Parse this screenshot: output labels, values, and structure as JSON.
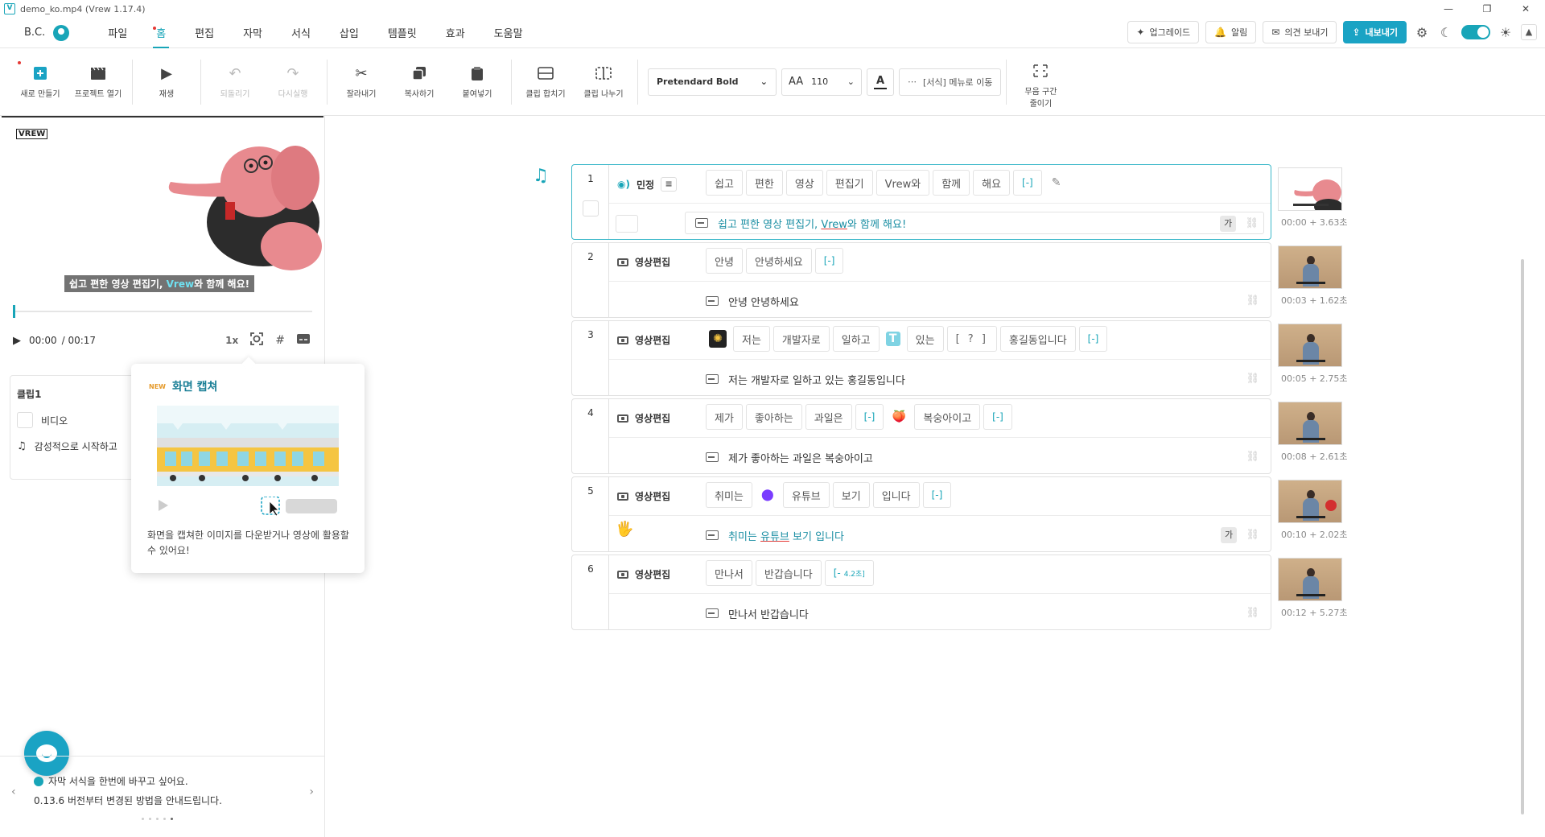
{
  "window": {
    "title": "demo_ko.mp4 (Vrew 1.17.4)",
    "controls": [
      "—",
      "❐",
      "✕"
    ]
  },
  "menubar": {
    "user": "B.C.",
    "items": [
      "파일",
      "홈",
      "편집",
      "자막",
      "서식",
      "삽입",
      "템플릿",
      "효과",
      "도움말"
    ],
    "active": "홈",
    "upgrade": "업그레이드",
    "notifications": "알림",
    "feedback": "의견 보내기",
    "export": "내보내기"
  },
  "toolbar": {
    "new": "새로 만들기",
    "open": "프로젝트 열기",
    "play": "재생",
    "undo": "되돌리기",
    "redo": "다시실행",
    "cut": "잘라내기",
    "copy": "복사하기",
    "paste": "붙여넣기",
    "merge": "클립 합치기",
    "split": "클립 나누기",
    "font": "Pretendard Bold",
    "font_size": "110",
    "color_glyph": "A",
    "more": "[서식] 메뉴로 이동",
    "silence_line1": "무음 구간",
    "silence_line2": "줄이기"
  },
  "preview": {
    "logo": "VREW",
    "subtitle_pre": "쉽고 편한 영상 편집기, ",
    "subtitle_hl": "Vrew",
    "subtitle_post": "와 함께 해요!",
    "current_time": "00:00",
    "duration": "/ 00:17",
    "speed": "1x",
    "progress": 0.0
  },
  "clip_panel": {
    "title": "클립1",
    "video_label": "비디오",
    "music_label": "감성적으로 시작하고"
  },
  "popover": {
    "badge": "NEW",
    "title": "화면 캡쳐",
    "description": "화면을 캡쳐한 이미지를 다운받거나 영상에 활용할 수 있어요!"
  },
  "tip": {
    "line1": "자막 서식을 한번에 바꾸고 싶어요.",
    "line2": "0.13.6 버전부터 변경된 방법을 안내드립니다.",
    "prev": "‹",
    "next": "›"
  },
  "clips": [
    {
      "num": "1",
      "speaker": "민정",
      "selected": true,
      "words": [
        "쉽고",
        "편한",
        "영상",
        "편집기",
        "Vrew와",
        "함께",
        "해요"
      ],
      "gap": "[-]",
      "subtitle_pre": "쉽고 편한 영상 편집기, ",
      "subtitle_ul": "Vrew",
      "subtitle_post": "와 함께 해요!",
      "ga": "가",
      "time": "00:00 + 3.63초"
    },
    {
      "num": "2",
      "speaker": "영상편집",
      "words": [
        "안녕",
        "안녕하세요"
      ],
      "gap": "[-]",
      "subtitle": "안녕 안녕하세요",
      "time": "00:03 + 1.62초"
    },
    {
      "num": "3",
      "speaker": "영상편집",
      "words_a": [
        "저는",
        "개발자로",
        "일하고"
      ],
      "t_icon": "T",
      "words_b": [
        "있는"
      ],
      "sym": "[ ? ]",
      "words_c": [
        "홍길동입니다"
      ],
      "gap": "[-]",
      "subtitle": "저는 개발자로 일하고 있는 홍길동입니다",
      "time": "00:05 + 2.75초"
    },
    {
      "num": "4",
      "speaker": "영상편집",
      "words_a": [
        "제가",
        "좋아하는",
        "과일은"
      ],
      "gap": "[-]",
      "words_b": [
        "복숭아이고"
      ],
      "subtitle": "제가 좋아하는 과일은 복숭아이고",
      "time": "00:08 + 2.61초"
    },
    {
      "num": "5",
      "speaker": "영상편집",
      "words_a": [
        "취미는"
      ],
      "words_b": [
        "유튜브",
        "보기",
        "입니다"
      ],
      "gap": "[-]",
      "subtitle_pre": "취미는 ",
      "subtitle_ul": "유튜브",
      "subtitle_post": " 보기 입니다",
      "ga": "가",
      "time": "00:10 + 2.02초"
    },
    {
      "num": "6",
      "speaker": "영상편집",
      "words": [
        "만나서",
        "반갑습니다"
      ],
      "gap": "[-",
      "gap_small": "4.2초]",
      "subtitle": "만나서 반갑습니다",
      "time": "00:12 + 5.27초"
    }
  ],
  "colors": {
    "accent": "#18a5b8",
    "export_button": "#1aa3c4",
    "notification_dot": "#e53935"
  }
}
